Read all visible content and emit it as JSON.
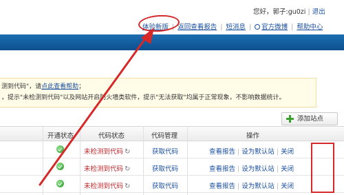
{
  "header": {
    "greeting": "您好，郭子",
    "username": ":gu0zi",
    "logout_label": "退出",
    "nav": {
      "new_version": "体验新版",
      "old_reports": "返回查看报告",
      "messages": "短消息",
      "weibo": "官方微博",
      "help": "帮助中心"
    }
  },
  "notice": {
    "line1_text": "测到代码\"，请",
    "line1_link": "点此查看帮助",
    "line1_end": "；",
    "line2": "，提示\"未检测到代码\"以及网站开启防火墙类软件，提示\"无法获取\"均属于正常现象，不影响数据统计。"
  },
  "add_site_label": "添加站点",
  "table": {
    "headers": {
      "status": "开通状态",
      "code_status": "代码状态",
      "code_manage": "代码管理",
      "actions": "操作"
    },
    "rows": [
      {
        "code_status": "未检测到代码",
        "get_code": "获取代码",
        "view": "查看报告",
        "set_default": "设为默认站",
        "close": "关闭"
      },
      {
        "code_status": "未检测到代码",
        "get_code": "获取代码",
        "view": "查看报告",
        "set_default": "设为默认站",
        "close": "关闭"
      },
      {
        "code_status": "未检测到代码",
        "get_code": "获取代码",
        "view": "查看报告",
        "set_default": "设为默认站",
        "close": "关闭"
      }
    ]
  },
  "colors": {
    "band": "#0d4f8f",
    "link": "#1a4fa0",
    "warning_text": "#c0282b",
    "annotation": "#d62828"
  }
}
